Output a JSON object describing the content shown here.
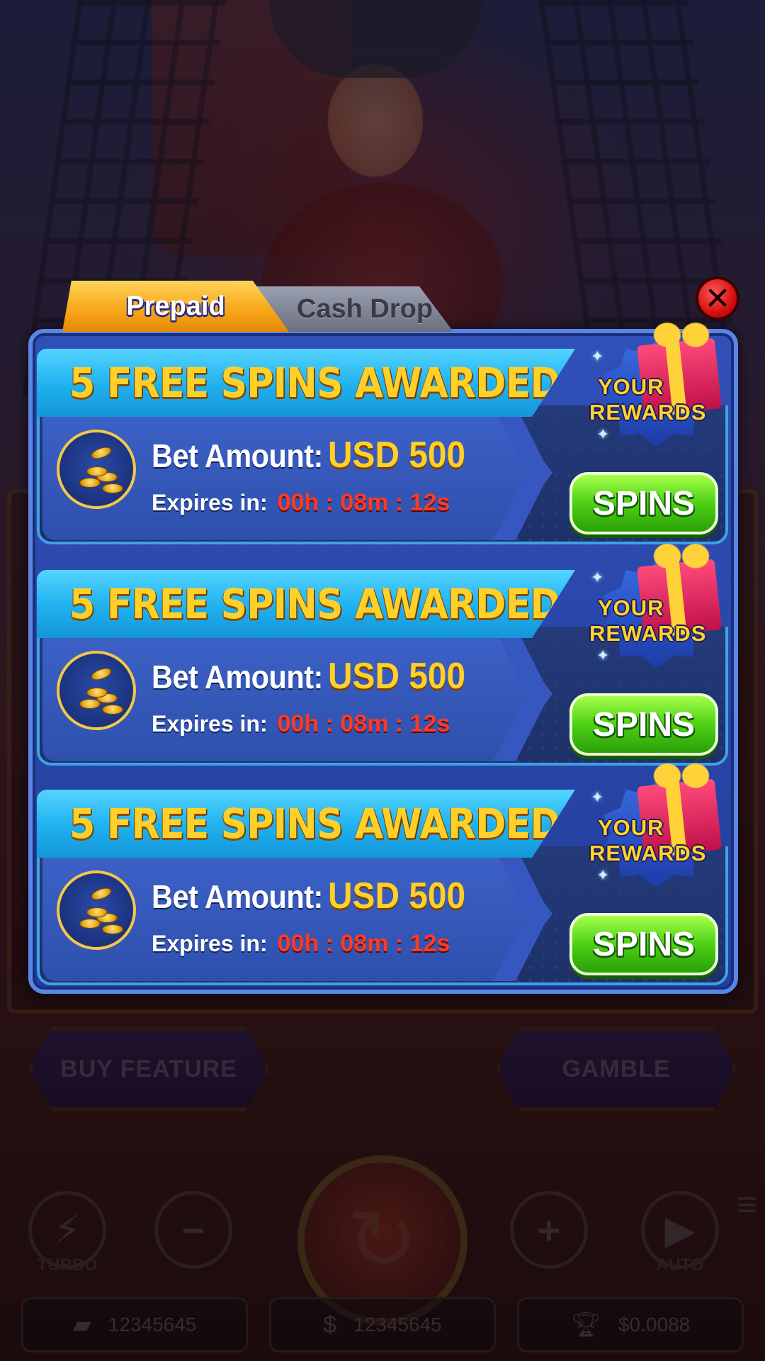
{
  "tabs": [
    {
      "label": "Prepaid",
      "active": true
    },
    {
      "label": "Cash Drop",
      "active": false
    }
  ],
  "close_icon": "close-x-icon",
  "rewards": [
    {
      "title": "5 FREE SPINS AWARDED",
      "bet_label": "Bet Amount:",
      "bet_value": "USD 500",
      "expires_label": "Expires in:",
      "expires_value": "00h : 08m : 12s",
      "button_label": "SPINS",
      "badge_line1": "YOUR",
      "badge_line2": "REWARDS"
    },
    {
      "title": "5 FREE SPINS AWARDED",
      "bet_label": "Bet Amount:",
      "bet_value": "USD 500",
      "expires_label": "Expires in:",
      "expires_value": "00h : 08m : 12s",
      "button_label": "SPINS",
      "badge_line1": "YOUR",
      "badge_line2": "REWARDS"
    },
    {
      "title": "5 FREE SPINS AWARDED",
      "bet_label": "Bet Amount:",
      "bet_value": "USD 500",
      "expires_label": "Expires in:",
      "expires_value": "00h : 08m : 12s",
      "button_label": "SPINS",
      "badge_line1": "YOUR",
      "badge_line2": "REWARDS"
    }
  ],
  "background_game": {
    "buy_feature_label": "BUY FEATURE",
    "gamble_label": "GAMBLE",
    "turbo_label": "TURBO",
    "auto_label": "AUTO",
    "wallet_balance": "12345645",
    "coin_balance": "12345645",
    "win_amount": "$0.0088"
  },
  "colors": {
    "accent_gold": "#ffcf2a",
    "panel_blue": "#3050b8",
    "header_cyan": "#1fb0ef",
    "button_green": "#4ed016",
    "timer_red": "#ff3a24",
    "tab_orange": "#f7a516",
    "close_red": "#d41010"
  }
}
